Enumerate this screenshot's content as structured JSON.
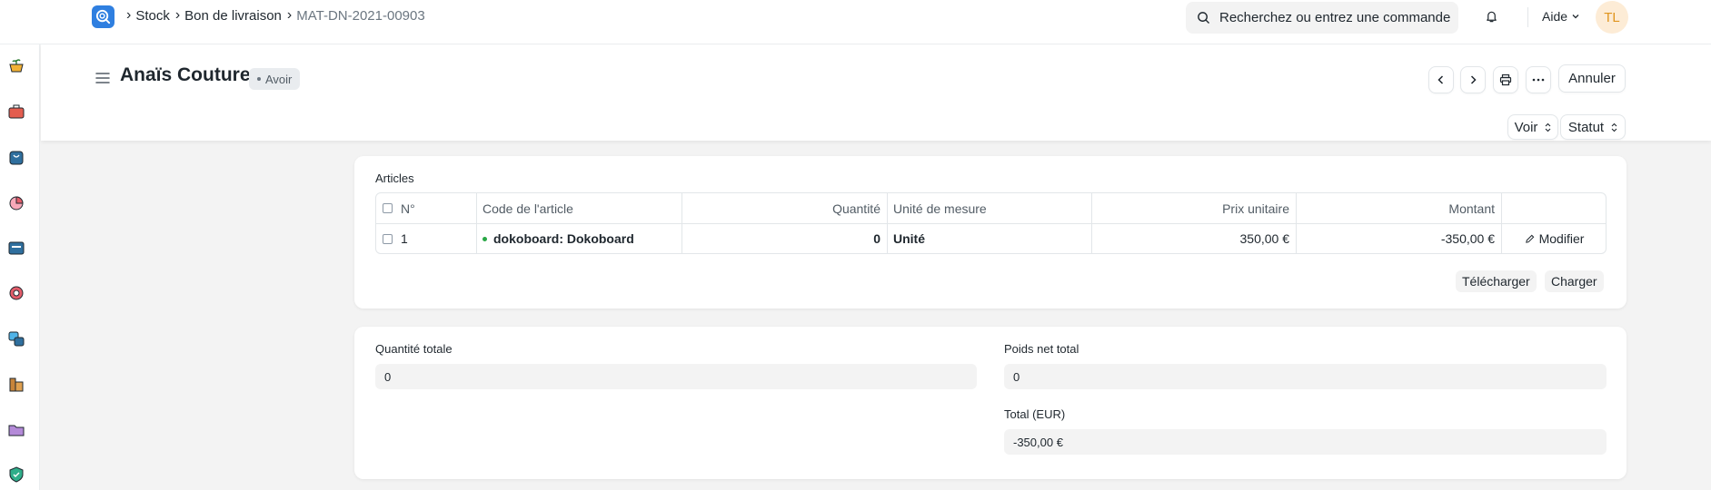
{
  "breadcrumb": {
    "items": [
      "Stock",
      "Bon de livraison"
    ],
    "current": "MAT-DN-2021-00903"
  },
  "search": {
    "placeholder": "Recherchez ou entrez une commande"
  },
  "nav": {
    "help_label": "Aide",
    "avatar_initials": "TL"
  },
  "page": {
    "title": "Anaïs Couture",
    "status_badge": "Avoir",
    "cancel_label": "Annuler",
    "view_label": "Voir",
    "status_label": "Statut"
  },
  "items_section": {
    "label": "Articles",
    "columns": [
      "N°",
      "Code de l'article",
      "Quantité",
      "Unité de mesure",
      "Prix unitaire",
      "Montant"
    ],
    "rows": [
      {
        "no": "1",
        "item_code": "dokoboard: Dokoboard",
        "qty": "0",
        "uom": "Unité",
        "rate": "350,00 €",
        "amount": "-350,00 €",
        "edit_label": "Modifier"
      }
    ],
    "download_label": "Télécharger",
    "upload_label": "Charger"
  },
  "totals": {
    "total_qty_label": "Quantité totale",
    "total_qty": "0",
    "total_net_weight_label": "Poids net total",
    "total_net_weight": "0",
    "total_label": "Total (EUR)",
    "total": "-350,00 €"
  },
  "colors": {
    "accent": "#2f7fe0",
    "status_dot": "#28a745",
    "avatar_bg": "#fdecd6",
    "avatar_fg": "#e0951e"
  }
}
